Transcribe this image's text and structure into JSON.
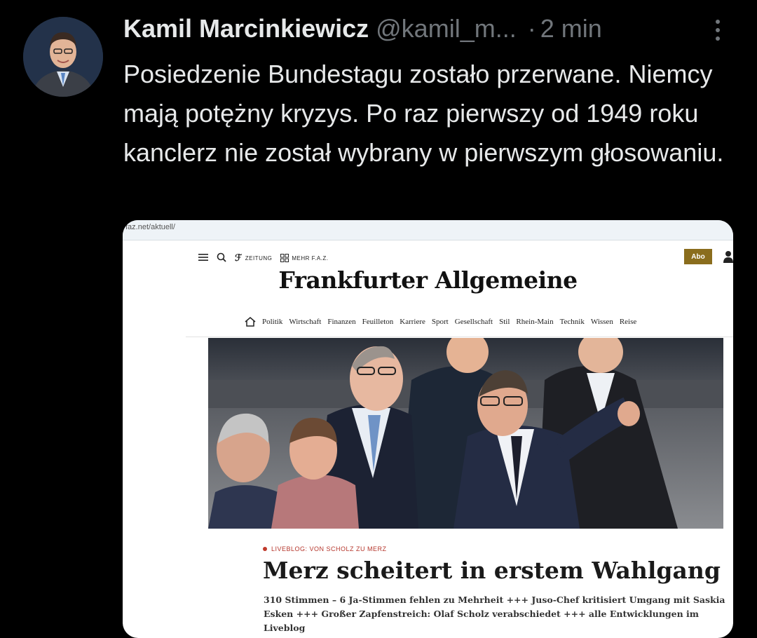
{
  "tweet": {
    "author_name": "Kamil Marcinkiewicz",
    "handle": "@kamil_m...",
    "separator": "·",
    "time": "2 min",
    "text": "Posiedzenie Bundestagu zostało przerwane. Niemcy mają potężny kryzys. Po raz pierwszy od 1949 roku kanclerz nie został wybrany w pierwszym głosowaniu."
  },
  "media": {
    "url": "faz.net/aktuell/",
    "nav": {
      "zeitung": "ZEITUNG",
      "mehr": "MEHR F.A.Z.",
      "abo": "Abo"
    },
    "masthead": "Frankfurter Allgemeine",
    "sections": [
      "Politik",
      "Wirtschaft",
      "Finanzen",
      "Feuilleton",
      "Karriere",
      "Sport",
      "Gesellschaft",
      "Stil",
      "Rhein-Main",
      "Technik",
      "Wissen",
      "Reise"
    ],
    "article": {
      "kicker": "LIVEBLOG: VON SCHOLZ ZU MERZ",
      "headline": "Merz scheitert in erstem Wahlgang",
      "teaser": "310 Stimmen – 6 Ja-Stimmen fehlen zu Mehrheit +++ Juso-Chef kritisiert Umgang mit Saskia Esken +++ Großer Zapfenstreich: Olaf Scholz verabschiedet +++ alle Entwicklungen im Liveblog"
    }
  },
  "icons": {
    "more": "more-vertical-icon",
    "menu": "hamburger-menu-icon",
    "search": "search-icon",
    "grid": "grid-icon",
    "home": "home-icon",
    "user": "user-icon"
  }
}
